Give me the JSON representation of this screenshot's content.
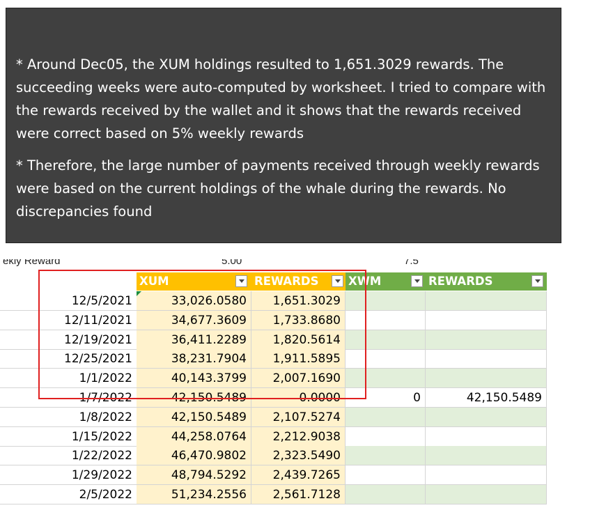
{
  "note": {
    "paragraph1": "* Around Dec05, the XUM holdings resulted to 1,651.3029 rewards.  The succeeding weeks were auto-computed by worksheet. I tried to compare with the rewards received by the wallet and it shows that the rewards received were correct based on 5% weekly rewards",
    "paragraph2": "* Therefore, the large number of payments received through weekly rewards were based on the current holdings of the whale during the rewards. No discrepancies found"
  },
  "sheet": {
    "cut_label_left": "ekly Reward",
    "cut_value_1": "5.00",
    "cut_value_2": "7.5",
    "headers": [
      "XUM",
      "REWARDS",
      "XWM",
      "REWARDS"
    ],
    "colors": {
      "yellow_header": "#ffc000",
      "green_header": "#70ad47",
      "yellow_fill": "#fff2cc",
      "green_fill": "#e2efda",
      "highlight": "#e02020"
    },
    "rows": [
      {
        "date": "12/5/2021",
        "xum": "33,026.0580",
        "rewards": "1,651.3029",
        "xwm": "",
        "rewards2": ""
      },
      {
        "date": "12/11/2021",
        "xum": "34,677.3609",
        "rewards": "1,733.8680",
        "xwm": "",
        "rewards2": ""
      },
      {
        "date": "12/19/2021",
        "xum": "36,411.2289",
        "rewards": "1,820.5614",
        "xwm": "",
        "rewards2": ""
      },
      {
        "date": "12/25/2021",
        "xum": "38,231.7904",
        "rewards": "1,911.5895",
        "xwm": "",
        "rewards2": ""
      },
      {
        "date": "1/1/2022",
        "xum": "40,143.3799",
        "rewards": "2,007.1690",
        "xwm": "",
        "rewards2": ""
      },
      {
        "date": "1/7/2022",
        "xum": "42,150.5489",
        "rewards": "0.0000",
        "xwm": "0",
        "rewards2": "42,150.5489"
      },
      {
        "date": "1/8/2022",
        "xum": "42,150.5489",
        "rewards": "2,107.5274",
        "xwm": "",
        "rewards2": ""
      },
      {
        "date": "1/15/2022",
        "xum": "44,258.0764",
        "rewards": "2,212.9038",
        "xwm": "",
        "rewards2": ""
      },
      {
        "date": "1/22/2022",
        "xum": "46,470.9802",
        "rewards": "2,323.5490",
        "xwm": "",
        "rewards2": ""
      },
      {
        "date": "1/29/2022",
        "xum": "48,794.5292",
        "rewards": "2,439.7265",
        "xwm": "",
        "rewards2": ""
      },
      {
        "date": "2/5/2022",
        "xum": "51,234.2556",
        "rewards": "2,561.7128",
        "xwm": "",
        "rewards2": ""
      }
    ]
  }
}
